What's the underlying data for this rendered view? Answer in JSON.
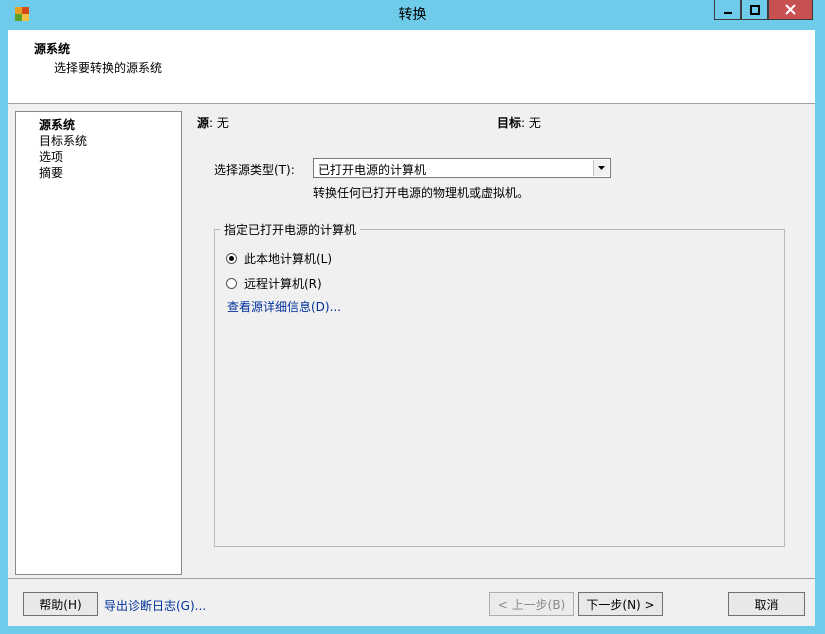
{
  "window": {
    "title": "转换",
    "colors": {
      "frame": "#6ecbea",
      "close": "#c75050",
      "link": "#00309c"
    }
  },
  "header": {
    "title": "源系统",
    "subtitle": "选择要转换的源系统"
  },
  "steps": [
    {
      "label": "源系统",
      "active": true
    },
    {
      "label": "目标系统",
      "active": false
    },
    {
      "label": "选项",
      "active": false
    },
    {
      "label": "摘要",
      "active": false
    }
  ],
  "source": {
    "label": "源",
    "value": "无"
  },
  "target": {
    "label": "目标",
    "value": "无"
  },
  "source_type": {
    "label": "选择源类型(T):",
    "selected": "已打开电源的计算机",
    "help": "转换任何已打开电源的物理机或虚拟机。"
  },
  "group": {
    "title": "指定已打开电源的计算机",
    "options": [
      {
        "label": "此本地计算机(L)",
        "checked": true
      },
      {
        "label": "远程计算机(R)",
        "checked": false
      }
    ],
    "details_link": "查看源详细信息(D)..."
  },
  "footer": {
    "help": "帮助(H)",
    "export_link": "导出诊断日志(G)...",
    "back": "< 上一步(B)",
    "next": "下一步(N) >",
    "cancel": "取消"
  }
}
